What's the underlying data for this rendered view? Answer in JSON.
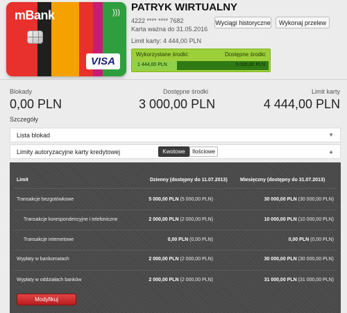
{
  "card": {
    "brand": "mBank",
    "network": "VISA",
    "stripe_colors": [
      "#e8312c",
      "#1f1f1f",
      "#f5a100",
      "#e8312c",
      "#c51d75",
      "#2f9e3f"
    ]
  },
  "header": {
    "holder_name": "PATRYK WIRTUALNY",
    "card_number": "4222 **** **** 7682",
    "validity": "Karta ważna do 31.05.2016",
    "card_limit": "Limit karty: 4 444,00 PLN",
    "history_button": "Wyciągi historyczne",
    "transfer_button": "Wykonaj przelew"
  },
  "usage": {
    "used_label": "Wykorzystane środki:",
    "available_label": "Dostępne środki:",
    "used_value": "1 444,00 PLN",
    "available_value": "3 000,00 PLN",
    "used_fraction": 0.325
  },
  "summary": {
    "blocks_label": "Blokady",
    "blocks_value": "0,00 PLN",
    "available_label": "Dostępne środki",
    "available_value": "3 000,00 PLN",
    "limit_label": "Limit karty",
    "limit_value": "4 444,00 PLN"
  },
  "details": {
    "title": "Szczegóły",
    "block_list": "Lista blokad",
    "auth_limits": "Limity autoryzacyjne karty kredytowej",
    "tab_amount": "Kwotowe",
    "tab_count": "Ilościowe"
  },
  "limits_table": {
    "col_limit": "Limit",
    "col_daily": "Dzienny (dostępny do 11.07.2013)",
    "col_monthly": "Miesięczny (dostępny do 31.07.2013)",
    "rows": [
      {
        "name": "Transakcje bezgotówkowe",
        "daily": "5 000,00 PLN",
        "daily_avail": "(5 000,00 PLN)",
        "monthly": "30 000,00 PLN",
        "monthly_avail": "(30 000,00 PLN)"
      },
      {
        "name": "Transakcje korespondencyjne i telefoniczne",
        "daily": "2 000,00 PLN",
        "daily_avail": "(2 000,00 PLN)",
        "monthly": "10 000,00 PLN",
        "monthly_avail": "(10 000,00 PLN)"
      },
      {
        "name": "Transakcje internetowe",
        "daily": "0,00 PLN",
        "daily_avail": "(0,00 PLN)",
        "monthly": "0,00 PLN",
        "monthly_avail": "(0,00 PLN)"
      },
      {
        "name": "Wypłaty w bankomatach",
        "daily": "2 000,00 PLN",
        "daily_avail": "(2 000,00 PLN)",
        "monthly": "30 000,00 PLN",
        "monthly_avail": "(30 000,00 PLN)"
      },
      {
        "name": "Wypłaty w oddziałach banków",
        "daily": "2 000,00 PLN",
        "daily_avail": "(2 000,00 PLN)",
        "monthly": "31 000,00 PLN",
        "monthly_avail": "(31 000,00 PLN)"
      }
    ],
    "modify_button": "Modyfikuj"
  }
}
